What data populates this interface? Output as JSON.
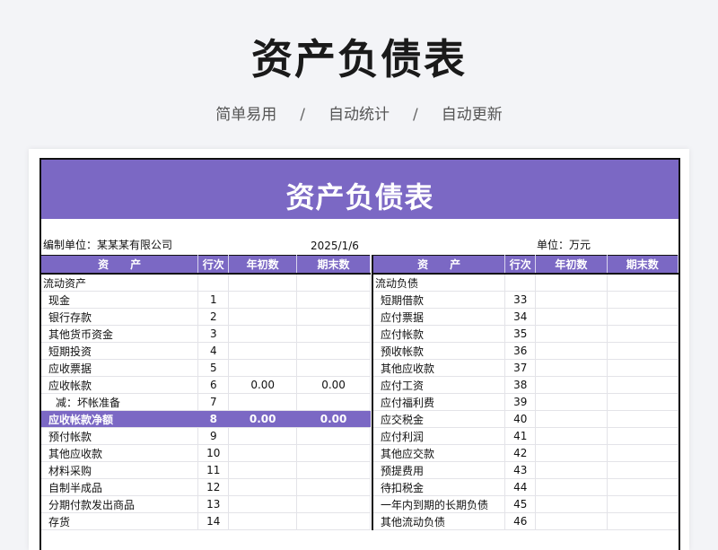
{
  "hero": {
    "title": "资产负债表",
    "tags": [
      "简单易用",
      "自动统计",
      "自动更新"
    ],
    "separator": "/"
  },
  "sheet": {
    "banner": "资产负债表",
    "org_label": "编制单位：某某某有限公司",
    "date": "2025/1/6",
    "unit": "单位：万元",
    "accent_color": "#7b68c4"
  },
  "left_table": {
    "headers": [
      "资　　产",
      "行次",
      "年初数",
      "期末数"
    ],
    "rows": [
      {
        "name": "流动资产",
        "line": "",
        "start": "",
        "end": ""
      },
      {
        "name": "现金",
        "line": "1",
        "start": "",
        "end": ""
      },
      {
        "name": "银行存款",
        "line": "2",
        "start": "",
        "end": ""
      },
      {
        "name": "其他货币资金",
        "line": "3",
        "start": "",
        "end": ""
      },
      {
        "name": "短期投资",
        "line": "4",
        "start": "",
        "end": ""
      },
      {
        "name": "应收票据",
        "line": "5",
        "start": "",
        "end": ""
      },
      {
        "name": "应收帐款",
        "line": "6",
        "start": "0.00",
        "end": "0.00"
      },
      {
        "name": "减：坏帐准备",
        "line": "7",
        "start": "",
        "end": ""
      },
      {
        "name": "应收帐款净额",
        "line": "8",
        "start": "0.00",
        "end": "0.00"
      },
      {
        "name": "预付帐款",
        "line": "9",
        "start": "",
        "end": ""
      },
      {
        "name": "其他应收款",
        "line": "10",
        "start": "",
        "end": ""
      },
      {
        "name": "材料采购",
        "line": "11",
        "start": "",
        "end": ""
      },
      {
        "name": "自制半成品",
        "line": "12",
        "start": "",
        "end": ""
      },
      {
        "name": "分期付款发出商品",
        "line": "13",
        "start": "",
        "end": ""
      },
      {
        "name": "存货",
        "line": "14",
        "start": "",
        "end": ""
      }
    ]
  },
  "right_table": {
    "headers": [
      "资　　产",
      "行次",
      "年初数",
      "期末数"
    ],
    "rows": [
      {
        "name": "流动负债",
        "line": "",
        "start": "",
        "end": ""
      },
      {
        "name": "短期借款",
        "line": "33",
        "start": "",
        "end": ""
      },
      {
        "name": "应付票据",
        "line": "34",
        "start": "",
        "end": ""
      },
      {
        "name": "应付帐款",
        "line": "35",
        "start": "",
        "end": ""
      },
      {
        "name": "预收帐款",
        "line": "36",
        "start": "",
        "end": ""
      },
      {
        "name": "其他应收款",
        "line": "37",
        "start": "",
        "end": ""
      },
      {
        "name": "应付工资",
        "line": "38",
        "start": "",
        "end": ""
      },
      {
        "name": "应付福利费",
        "line": "39",
        "start": "",
        "end": ""
      },
      {
        "name": "应交税金",
        "line": "40",
        "start": "",
        "end": ""
      },
      {
        "name": "应付利润",
        "line": "41",
        "start": "",
        "end": ""
      },
      {
        "name": "其他应交款",
        "line": "42",
        "start": "",
        "end": ""
      },
      {
        "name": "预提费用",
        "line": "43",
        "start": "",
        "end": ""
      },
      {
        "name": "待扣税金",
        "line": "44",
        "start": "",
        "end": ""
      },
      {
        "name": "一年内到期的长期负债",
        "line": "45",
        "start": "",
        "end": ""
      },
      {
        "name": "其他流动负债",
        "line": "46",
        "start": "",
        "end": ""
      }
    ]
  }
}
